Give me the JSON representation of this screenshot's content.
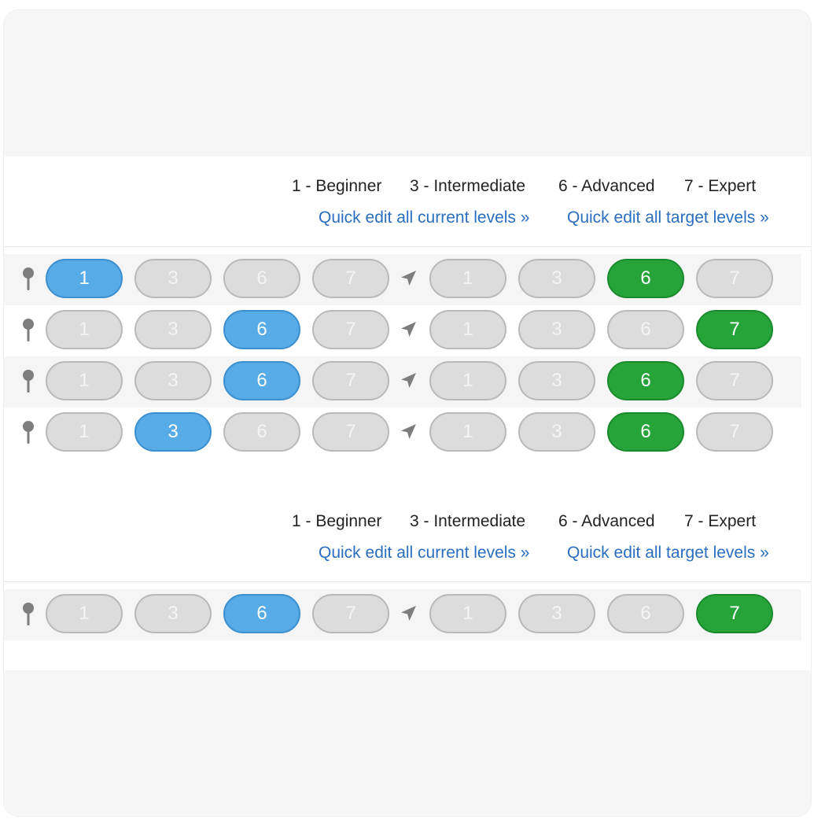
{
  "legend": [
    "1 - Beginner",
    "3 - Intermediate",
    "6 - Advanced",
    "7 - Expert"
  ],
  "links": {
    "current": "Quick edit all current levels »",
    "target": "Quick edit all target levels »"
  },
  "levels": [
    "1",
    "3",
    "6",
    "7"
  ],
  "colors": {
    "current_selected": "#57abe6",
    "target_selected": "#26a43a",
    "unselected": "#dcdcdc"
  },
  "icons": {
    "current": "pin-icon",
    "target": "navigation-arrow-icon"
  },
  "sections": [
    {
      "rows": [
        {
          "current": "1",
          "target": "6"
        },
        {
          "current": "6",
          "target": "7"
        },
        {
          "current": "6",
          "target": "6"
        },
        {
          "current": "3",
          "target": "6"
        }
      ]
    },
    {
      "rows": [
        {
          "current": "6",
          "target": "7"
        }
      ]
    }
  ]
}
